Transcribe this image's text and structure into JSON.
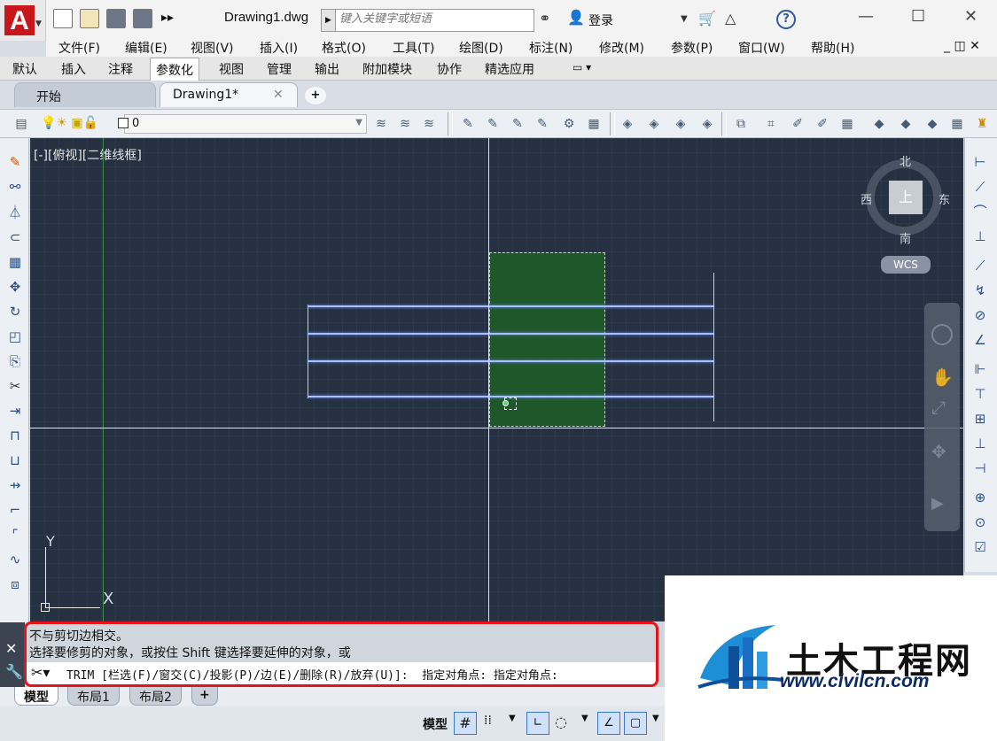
{
  "app": {
    "title": "Drawing1.dwg",
    "logo": "A",
    "search_placeholder": "键入关键字或短语",
    "login_label": "登录"
  },
  "menu": [
    "文件(F)",
    "编辑(E)",
    "视图(V)",
    "插入(I)",
    "格式(O)",
    "工具(T)",
    "绘图(D)",
    "标注(N)",
    "修改(M)",
    "参数(P)",
    "窗口(W)",
    "帮助(H)"
  ],
  "ribbon_tabs": [
    "默认",
    "插入",
    "注释",
    "参数化",
    "视图",
    "管理",
    "输出",
    "附加模块",
    "协作",
    "精选应用"
  ],
  "ribbon_active": "参数化",
  "file_tabs": {
    "start": "开始",
    "drawing": "Drawing1*"
  },
  "layer": {
    "name": "0"
  },
  "viewport": {
    "label": "[-][俯视][二维线框]"
  },
  "viewcube": {
    "north": "北",
    "south": "南",
    "east": "东",
    "west": "西",
    "face": "上",
    "wcs": "WCS"
  },
  "axis": {
    "y": "Y",
    "x": "X"
  },
  "command": {
    "history_line1": "不与剪切边相交。",
    "history_line2": "选择要修剪的对象，或按住 Shift 键选择要延伸的对象，或",
    "prompt": "TRIM [栏选(F)/窗交(C)/投影(P)/边(E)/删除(R)/放弃(U)]:  指定对角点: 指定对角点:"
  },
  "layout_tabs": [
    "模型",
    "布局1",
    "布局2"
  ],
  "status": {
    "model_label": "模型"
  },
  "watermark": {
    "title": "土木工程网",
    "url": "www.civilcn.com"
  },
  "colors": {
    "canvas": "#253040",
    "selection": "#1f5a2a",
    "highlight_line": "#9fb6ff",
    "callout": "#e3141a"
  }
}
